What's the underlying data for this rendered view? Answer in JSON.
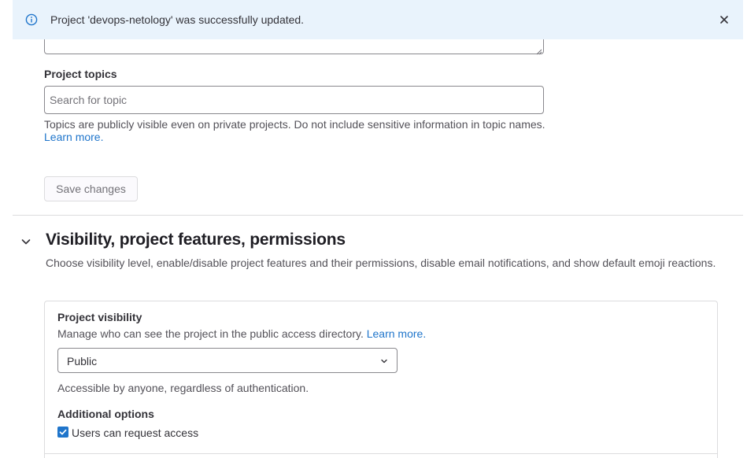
{
  "alert": {
    "message": "Project 'devops-netology' was successfully updated.",
    "icon": "info-icon",
    "close_icon": "close-icon",
    "background": "#e9f3fc"
  },
  "topics": {
    "label": "Project topics",
    "placeholder": "Search for topic",
    "value": "",
    "help_text": "Topics are publicly visible even on private projects. Do not include sensitive information in topic names.",
    "help_link": "Learn more."
  },
  "save_button": {
    "label": "Save changes"
  },
  "visibility_section": {
    "title": "Visibility, project features, permissions",
    "description": "Choose visibility level, enable/disable project features and their permissions, disable email notifications, and show default emoji reactions.",
    "expand_icon": "chevron-down-icon",
    "project_visibility": {
      "label": "Project visibility",
      "description": "Manage who can see the project in the public access directory.",
      "link": "Learn more.",
      "selected": "Public",
      "help": "Accessible by anyone, regardless of authentication."
    },
    "additional_options": {
      "label": "Additional options",
      "checkbox_label": "Users can request access",
      "checked": true
    }
  },
  "colors": {
    "accent": "#1f75cb",
    "text": "#333238",
    "muted": "#535158",
    "border": "#dcdcde"
  }
}
